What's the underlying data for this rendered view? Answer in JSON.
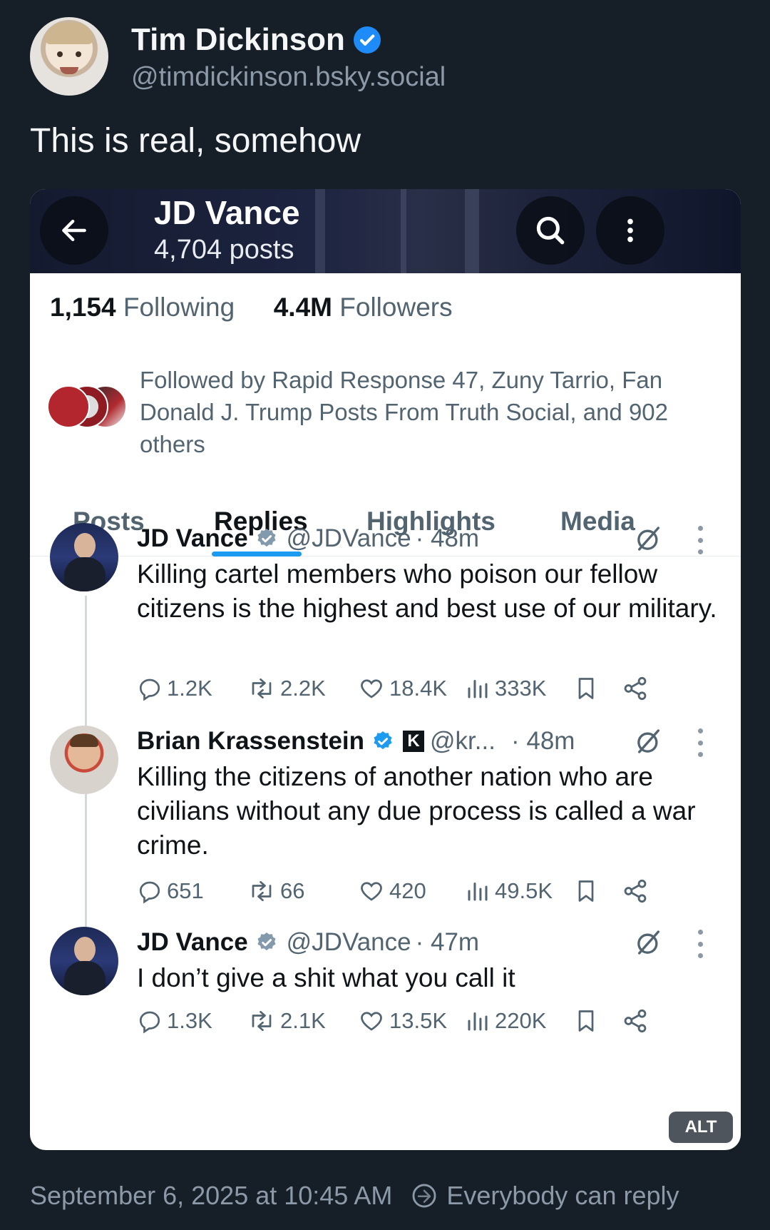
{
  "author": {
    "display_name": "Tim Dickinson",
    "handle": "@timdickinson.bsky.social",
    "verified": true,
    "avatar": "child-portrait-avatar"
  },
  "post": {
    "text": "This is real, somehow",
    "timestamp": "September 6, 2025 at 10:45 AM",
    "reply_setting": "Everybody can reply",
    "alt_badge": "ALT"
  },
  "embed": {
    "profile": {
      "name": "JD Vance",
      "posts_count": "4,704 posts",
      "following_count": "1,154",
      "following_label": "Following",
      "followers_count": "4.4M",
      "followers_label": "Followers",
      "followed_by": "Followed by Rapid Response 47, Zuny Tarrio, Fan Donald J. Trump Posts From Truth Social, and 902 others",
      "tabs": [
        {
          "label": "Posts",
          "active": false
        },
        {
          "label": "Replies",
          "active": true
        },
        {
          "label": "Highlights",
          "active": false
        },
        {
          "label": "Media",
          "active": false
        }
      ]
    },
    "tweets": [
      {
        "name": "JD Vance",
        "handle": "@JDVance",
        "time": "· 48m",
        "text": "Killing cartel members who poison our fellow citizens is the highest and best use of our military.",
        "replies": "1.2K",
        "reposts": "2.2K",
        "likes": "18.4K",
        "views": "333K"
      },
      {
        "name": "Brian Krassenstein",
        "handle": "@kr...",
        "time": "· 48m",
        "text": "Killing the citizens of another nation who are civilians without any due process is called a war crime.",
        "replies": "651",
        "reposts": "66",
        "likes": "420",
        "views": "49.5K"
      },
      {
        "name": "JD Vance",
        "handle": "@JDVance",
        "time": "· 47m",
        "text": "I don’t give a shit what you call it",
        "replies": "1.3K",
        "reposts": "2.1K",
        "likes": "13.5K",
        "views": "220K"
      }
    ]
  },
  "colors": {
    "background": "#161e27",
    "bluesky_verified": "#1d8cf8",
    "x_accent": "#1d9bf0",
    "gray_verified": "#829aab"
  }
}
